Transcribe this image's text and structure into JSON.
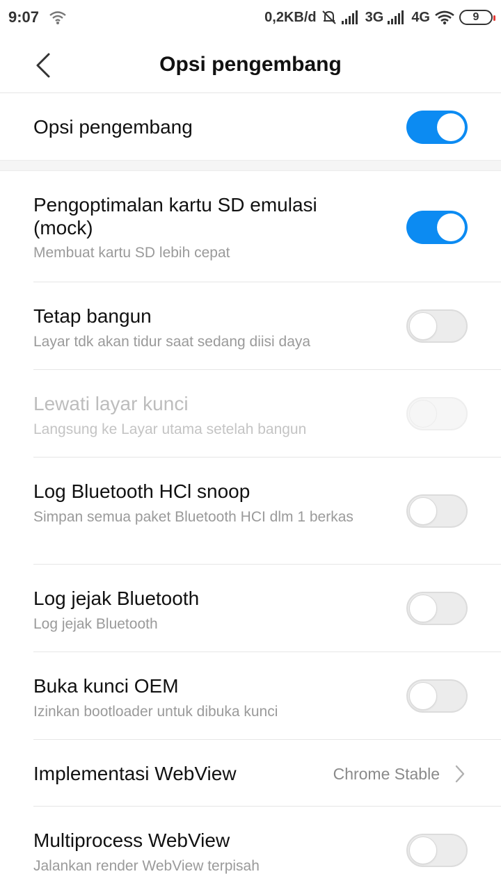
{
  "status_bar": {
    "time": "9:07",
    "net_speed": "0,2KB/d",
    "sim1_type": "3G",
    "sim2_type": "4G",
    "battery": "9"
  },
  "header": {
    "title": "Opsi pengembang",
    "back_icon": "chevron-left-icon"
  },
  "master": {
    "label": "Opsi pengembang",
    "enabled": true
  },
  "settings": [
    {
      "title": "Pengoptimalan kartu SD emulasi (mock)",
      "subtitle": "Membuat kartu SD lebih cepat",
      "state": "on"
    },
    {
      "title": "Tetap bangun",
      "subtitle": "Layar tdk akan tidur saat sedang diisi daya",
      "state": "off"
    },
    {
      "title": "Lewati layar kunci",
      "subtitle": "Langsung ke Layar utama setelah bangun",
      "state": "disabled"
    },
    {
      "title": "Log Bluetooth HCl snoop",
      "subtitle": "Simpan semua paket Bluetooth HCI dlm 1 berkas",
      "state": "off"
    },
    {
      "title": "Log jejak Bluetooth",
      "subtitle": "Log jejak Bluetooth",
      "state": "off"
    },
    {
      "title": "Buka kunci OEM",
      "subtitle": "Izinkan bootloader untuk dibuka kunci",
      "state": "off"
    },
    {
      "title": "Implementasi WebView",
      "value": "Chrome Stable"
    },
    {
      "title": "Multiprocess WebView",
      "subtitle": "Jalankan render WebView terpisah",
      "state": "off"
    }
  ],
  "colors": {
    "accent": "#0c8bf2",
    "muted_text": "#9a9a9a"
  }
}
